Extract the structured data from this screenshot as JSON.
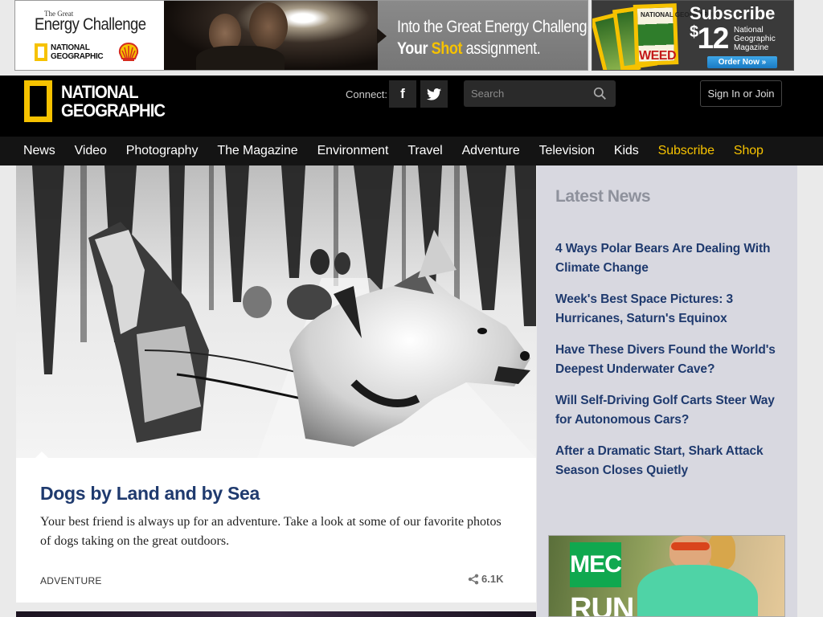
{
  "ads": {
    "energy": {
      "small_line": "The Great",
      "big_line": "Energy Challenge",
      "brand_line1": "NATIONAL",
      "brand_line2": "GEOGRAPHIC",
      "headline_line1": "Into the Great Energy Challenge",
      "headline_your": "Your",
      "headline_shot": "Shot",
      "headline_assignment": "assignment."
    },
    "subscribe": {
      "title": "Subscribe",
      "currency": "$",
      "price": "12",
      "desc_line1": "National",
      "desc_line2": "Geographic",
      "desc_line3": "Magazine",
      "cover_brand": "NATIONAL GEOGRAPHIC",
      "cover_word": "WEED",
      "button": "Order Now »"
    }
  },
  "header": {
    "logo_line1": "NATIONAL",
    "logo_line2": "GEOGRAPHIC",
    "connect_label": "Connect:",
    "facebook": "f",
    "search_placeholder": "Search",
    "signin_label": "Sign In or Join"
  },
  "nav": [
    {
      "label": "News"
    },
    {
      "label": "Video"
    },
    {
      "label": "Photography"
    },
    {
      "label": "The Magazine"
    },
    {
      "label": "Environment"
    },
    {
      "label": "Travel"
    },
    {
      "label": "Adventure"
    },
    {
      "label": "Television"
    },
    {
      "label": "Kids"
    },
    {
      "label": "Subscribe"
    },
    {
      "label": "Shop"
    }
  ],
  "feature": {
    "title": "Dogs by Land and by Sea",
    "dek": "Your best friend is always up for an adventure. Take a look at some of our favorite photos of dogs taking on the great outdoors.",
    "category": "ADVENTURE",
    "shares": "6.1K"
  },
  "sidebar": {
    "title": "Latest News",
    "items": [
      "4 Ways Polar Bears Are Dealing With Climate Change",
      "Week's Best Space Pictures: 3 Hurricanes, Saturn's Equinox",
      "Have These Divers Found the World's Deepest Underwater Cave?",
      "Will Self-Driving Golf Carts Steer Way for Autonomous Cars?",
      "After a Dramatic Start, Shark Attack Season Closes Quietly"
    ],
    "ad_logo": "MEC",
    "ad_word": "RUN"
  },
  "colors": {
    "brand_yellow": "#f6c200",
    "headline_blue": "#1f3a6e",
    "header_black": "#000000",
    "sidebar_bg": "#d8d8e0"
  }
}
